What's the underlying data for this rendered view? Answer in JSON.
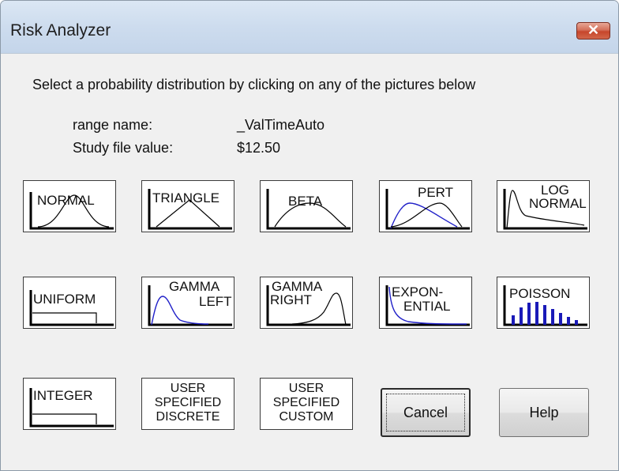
{
  "window": {
    "title": "Risk Analyzer",
    "close_glyph": "✕"
  },
  "instruction": "Select a probability distribution by clicking on any of the pictures below",
  "info": {
    "range_label": "range name:",
    "range_value": "_ValTimeAuto",
    "study_label": "Study file value:",
    "study_value": "$12.50"
  },
  "distributions": {
    "normal": "NORMAL",
    "triangle": "TRIANGLE",
    "beta": "BETA",
    "pert": "PERT",
    "lognormal": [
      "LOG",
      "NORMAL"
    ],
    "uniform": "UNIFORM",
    "gamma_left": [
      "GAMMA",
      "LEFT"
    ],
    "gamma_right": [
      "GAMMA",
      "RIGHT"
    ],
    "exponential": [
      "EXPON-",
      "ENTIAL"
    ],
    "poisson": "POISSON",
    "integer": "INTEGER",
    "user_discrete": [
      "USER",
      "SPECIFIED",
      "DISCRETE"
    ],
    "user_custom": [
      "USER",
      "SPECIFIED",
      "CUSTOM"
    ]
  },
  "buttons": {
    "cancel": "Cancel",
    "help": "Help"
  },
  "colors": {
    "curve": "#000000",
    "curve_alt": "#2020c8",
    "close_button": "#c7462b"
  }
}
